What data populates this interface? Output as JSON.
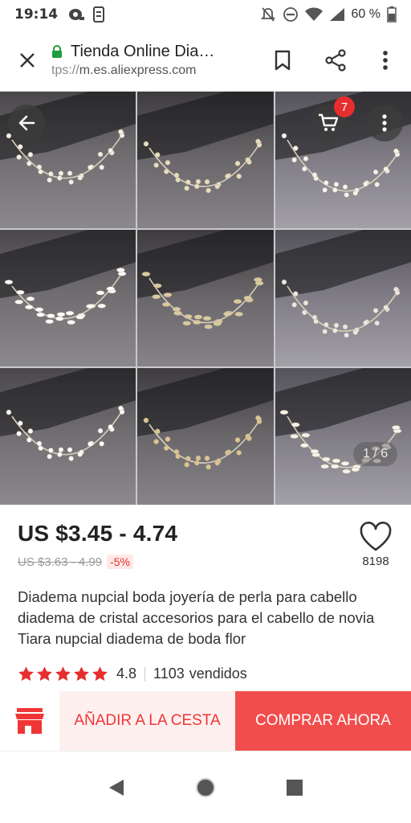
{
  "status_bar": {
    "time": "19:14",
    "battery": "60 %",
    "icons": [
      "notification-icon",
      "sim-icon",
      "mute-icon",
      "dnd-icon",
      "wifi-icon",
      "signal-icon",
      "battery-icon"
    ]
  },
  "browser": {
    "page_title": "Tienda Online Dia…",
    "url_prefix": "tps://",
    "url_host": "m.es.aliexpress.com",
    "icons": [
      "close-icon",
      "lock-icon",
      "bookmark-icon",
      "share-icon",
      "more-vert-icon"
    ]
  },
  "gallery": {
    "cart_count": "7",
    "page_indicator": "1 / 6",
    "tile_count": 9
  },
  "product": {
    "price": "US $3.45 - 4.74",
    "old_price": "US $3.63 - 4.99",
    "discount": "-5%",
    "favorites": "8198",
    "title": "Diadema nupcial boda joyería de perla para cabello diadema de cristal accesorios para el cabello de novia Tiara nupcial diadema de boda flor",
    "rating": "4.8",
    "sold_count": "1103",
    "sold_label": "vendidos",
    "stars": 5
  },
  "actions": {
    "add_to_cart": "AÑADIR A LA CESTA",
    "buy_now": "COMPRAR AHORA"
  },
  "colors": {
    "accent_red": "#f24d4d",
    "add_cart_bg": "#fff0f0",
    "secure_green": "#1e9e3c",
    "star_red": "#e62e2e"
  }
}
